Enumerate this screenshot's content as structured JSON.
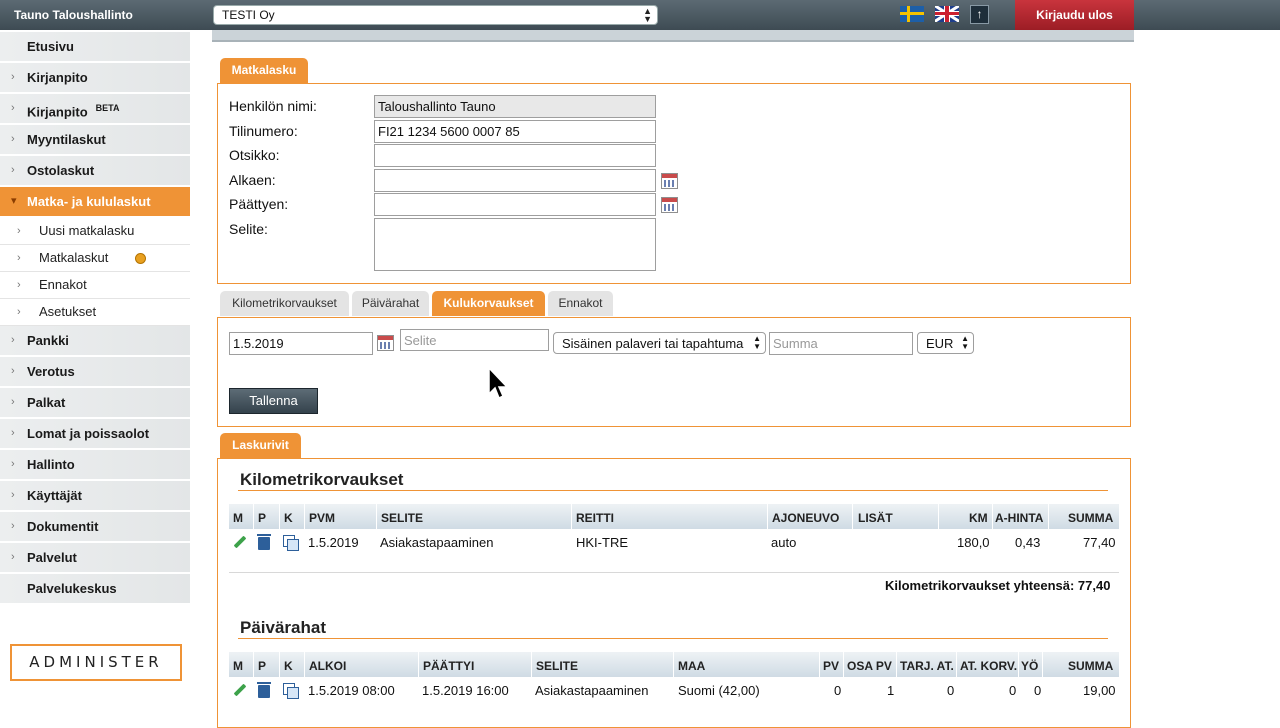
{
  "header": {
    "app_title": "Tauno Taloushallinto",
    "company": "TESTI Oy",
    "logout_label": "Kirjaudu ulos",
    "upload_icon": "↑"
  },
  "sidebar": {
    "items": [
      {
        "label": "Etusivu"
      },
      {
        "label": "Kirjanpito"
      },
      {
        "label": "Kirjanpito",
        "badge": "BETA"
      },
      {
        "label": "Myyntilaskut"
      },
      {
        "label": "Ostolaskut"
      },
      {
        "label": "Matka- ja kululaskut"
      },
      {
        "label": "Pankki"
      },
      {
        "label": "Verotus"
      },
      {
        "label": "Palkat"
      },
      {
        "label": "Lomat ja poissaolot"
      },
      {
        "label": "Hallinto"
      },
      {
        "label": "Käyttäjät"
      },
      {
        "label": "Dokumentit"
      },
      {
        "label": "Palvelut"
      },
      {
        "label": "Palvelukeskus"
      }
    ],
    "subitems": [
      {
        "label": "Uusi matkalasku"
      },
      {
        "label": "Matkalaskut"
      },
      {
        "label": "Ennakot"
      },
      {
        "label": "Asetukset"
      }
    ],
    "logo": "ADMINISTER"
  },
  "invoice": {
    "tab": "Matkalasku",
    "fields": {
      "name_label": "Henkilön nimi:",
      "name_value": "Taloushallinto Tauno",
      "account_label": "Tilinumero:",
      "account_value": "FI21 1234 5600 0007 85",
      "title_label": "Otsikko:",
      "start_label": "Alkaen:",
      "end_label": "Päättyen:",
      "desc_label": "Selite:"
    }
  },
  "expense_tabs": [
    "Kilometrikorvaukset",
    "Päivärahat",
    "Kulukorvaukset",
    "Ennakot"
  ],
  "expense_form": {
    "date": "1.5.2019",
    "desc_placeholder": "Selite",
    "type": "Sisäinen palaveri tai tapahtuma",
    "amount_placeholder": "Summa",
    "currency": "EUR",
    "save_label": "Tallenna"
  },
  "rows_panel": {
    "tab": "Laskurivit",
    "km": {
      "title": "Kilometrikorvaukset",
      "headers": [
        "M",
        "P",
        "K",
        "PVM",
        "SELITE",
        "REITTI",
        "AJONEUVO",
        "LISÄT",
        "KM",
        "A-HINTA",
        "SUMMA"
      ],
      "row": {
        "date": "1.5.2019",
        "desc": "Asiakastapaaminen",
        "route": "HKI-TRE",
        "vehicle": "auto",
        "km": "180,0",
        "price": "0,43",
        "sum": "77,40"
      },
      "total": "Kilometrikorvaukset yhteensä: 77,40"
    },
    "daily": {
      "title": "Päivärahat",
      "headers": [
        "M",
        "P",
        "K",
        "ALKOI",
        "PÄÄTTYI",
        "SELITE",
        "MAA",
        "PV",
        "OSA PV",
        "TARJ. AT.",
        "AT. KORV.",
        "YÖ",
        "SUMMA"
      ],
      "row": {
        "start": "1.5.2019 08:00",
        "end": "1.5.2019 16:00",
        "desc": "Asiakastapaaminen",
        "country": "Suomi (42,00)",
        "pv": "0",
        "osa_pv": "1",
        "tarj": "0",
        "korv": "0",
        "yo": "0",
        "sum": "19,00"
      }
    }
  }
}
